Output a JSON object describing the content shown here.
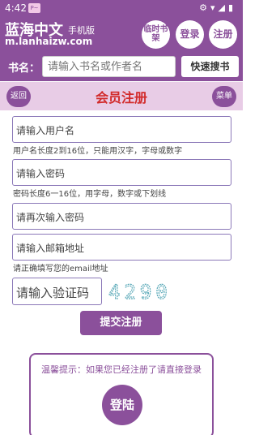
{
  "status_bar": {
    "time": "4:42",
    "app_badge": "P~",
    "icons": [
      "gear-icon",
      "wifi-icon",
      "signal-icon",
      "battery-icon"
    ]
  },
  "header": {
    "brand": "蓝海中文",
    "edition": "手机版",
    "domain": "m.lanhaizw.com",
    "temp_bookshelf": "临时书架",
    "login": "登录",
    "register": "注册"
  },
  "search": {
    "label": "书名：",
    "placeholder": "请输入书名或作者名",
    "button": "快速搜书"
  },
  "title_bar": {
    "back": "返回",
    "title": "会员注册",
    "menu": "菜单"
  },
  "form": {
    "username_placeholder": "请输入用户名",
    "username_hint": "用户名长度2到16位，只能用汉字，字母或数字",
    "password_placeholder": "请输入密码",
    "password_hint": "密码长度6一16位，用字母，数字或下划线",
    "confirm_placeholder": "请再次输入密码",
    "email_placeholder": "请输入邮箱地址",
    "email_hint": "请正确填写您的email地址",
    "captcha_placeholder": "请输入验证码",
    "captcha_code": "4290",
    "submit": "提交注册"
  },
  "notice": {
    "text": "温馨提示：如果您已经注册了请直接登录",
    "login": "登陆"
  },
  "colors": {
    "accent": "#8b509b",
    "title_red": "#d22a2a",
    "light_band": "#e8cce6",
    "captcha_teal": "#5aa9b8"
  }
}
